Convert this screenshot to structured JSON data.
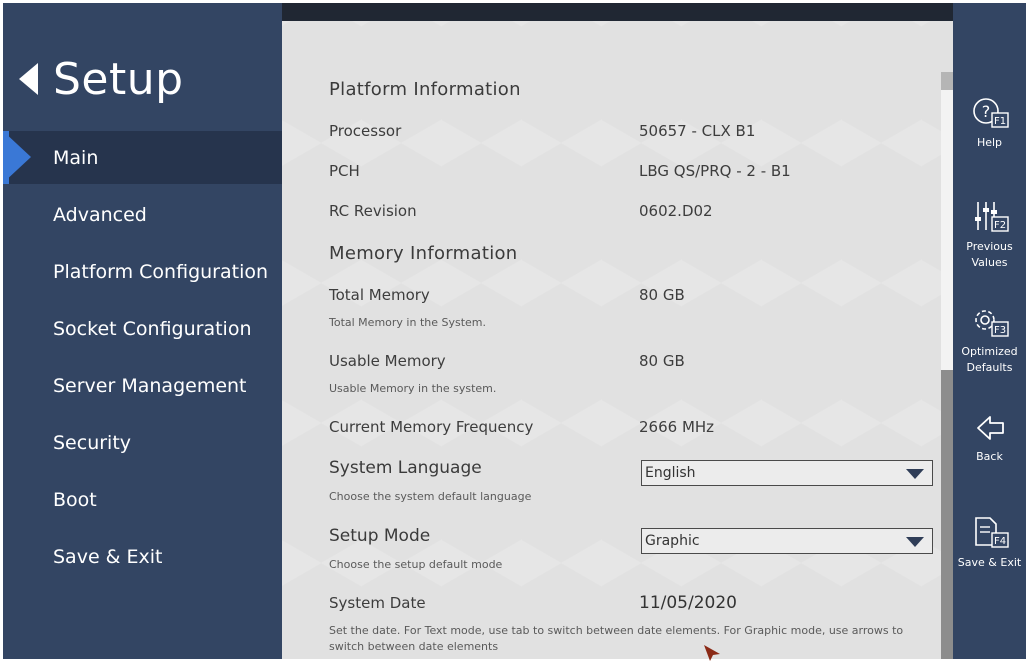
{
  "sidebar": {
    "title": "Setup",
    "items": [
      {
        "label": "Main"
      },
      {
        "label": "Advanced"
      },
      {
        "label": "Platform Configuration"
      },
      {
        "label": "Socket Configuration"
      },
      {
        "label": "Server Management"
      },
      {
        "label": "Security"
      },
      {
        "label": "Boot"
      },
      {
        "label": "Save & Exit"
      }
    ]
  },
  "main": {
    "platform": {
      "title": "Platform Information",
      "processor_label": "Processor",
      "processor_value": "50657 - CLX B1",
      "pch_label": "PCH",
      "pch_value": "LBG QS/PRQ - 2 - B1",
      "rc_label": "RC Revision",
      "rc_value": "0602.D02"
    },
    "memory": {
      "title": "Memory Information",
      "total_label": "Total Memory",
      "total_value": "80 GB",
      "total_help": "Total Memory in the System.",
      "usable_label": "Usable Memory",
      "usable_value": "80 GB",
      "usable_help": "Usable Memory in the system.",
      "freq_label": "Current Memory Frequency",
      "freq_value": "2666 MHz"
    },
    "language": {
      "label": "System Language",
      "value": "English",
      "help": "Choose the system default language"
    },
    "mode": {
      "label": "Setup Mode",
      "value": "Graphic",
      "help": "Choose the setup default mode"
    },
    "date": {
      "label": "System Date",
      "value": "11/05/2020",
      "help": "Set the date. For Text mode, use tab to switch between date elements. For Graphic mode, use arrows to switch between date elements"
    }
  },
  "rightbar": {
    "help": {
      "label": "Help",
      "key": "F1"
    },
    "previous": {
      "label": "Previous Values",
      "key": "F2"
    },
    "optimized": {
      "label": "Optimized Defaults",
      "key": "F3"
    },
    "back": {
      "label": "Back"
    },
    "save": {
      "label": "Save & Exit",
      "key": "F4"
    }
  },
  "colors": {
    "sidebar_bg": "#334563",
    "active_item_bg": "#26344d",
    "accent": "#3a78d6",
    "panel_bg": "#e1e1e1"
  }
}
